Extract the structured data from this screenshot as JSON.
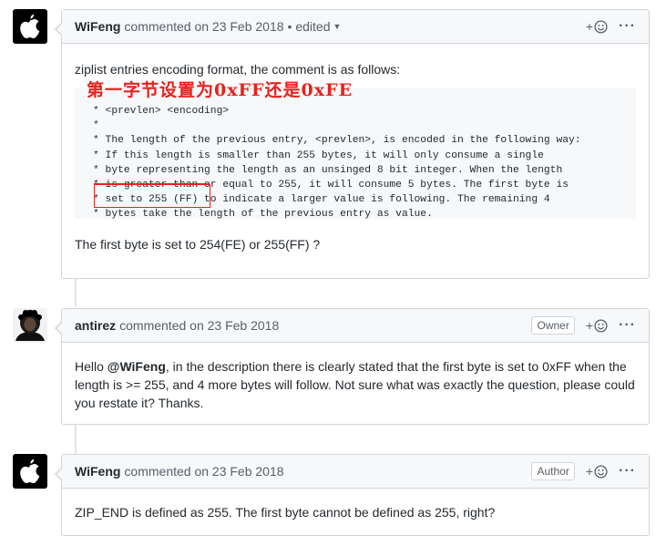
{
  "comment1": {
    "author": "WiFeng",
    "meta": "commented on 23 Feb 2018",
    "edited": "• edited",
    "intro": "ziplist entries encoding format, the comment is as follows:",
    "annotation": "第一字节设置为0xFF还是0xFE",
    "code_lines": [
      "* <prevlen> <encoding>",
      "*",
      "* The length of the previous entry, <prevlen>, is encoded in the following way:",
      "* If this length is smaller than 255 bytes, it will only consume a single",
      "* byte representing the length as an unsinged 8 bit integer. When the length",
      "* is greater than or equal to 255, it will consume 5 bytes. The first byte is",
      "* set to 255 (FF) to indicate a larger value is following. The remaining 4",
      "* bytes take the length of the previous entry as value."
    ],
    "question": "The first byte is set to 254(FE) or 255(FF) ?"
  },
  "comment2": {
    "author": "antirez",
    "meta": "commented on 23 Feb 2018",
    "badge": "Owner",
    "text_before": "Hello ",
    "mention": "@WiFeng",
    "text_after": ", in the description there is clearly stated that the first byte is set to 0xFF when the length is >= 255, and 4 more bytes will follow. Not sure what was exactly the question, please could you restate it? Thanks."
  },
  "comment3": {
    "author": "WiFeng",
    "meta": "commented on 23 Feb 2018",
    "badge": "Author",
    "text": "ZIP_END is defined as 255. The first byte cannot be defined as 255, right?"
  },
  "ui": {
    "react_plus": "+",
    "more": "···"
  },
  "colors": {
    "annotation": "#e8211c",
    "header_bg": "#f6f8fa",
    "border": "#d1d5da"
  }
}
